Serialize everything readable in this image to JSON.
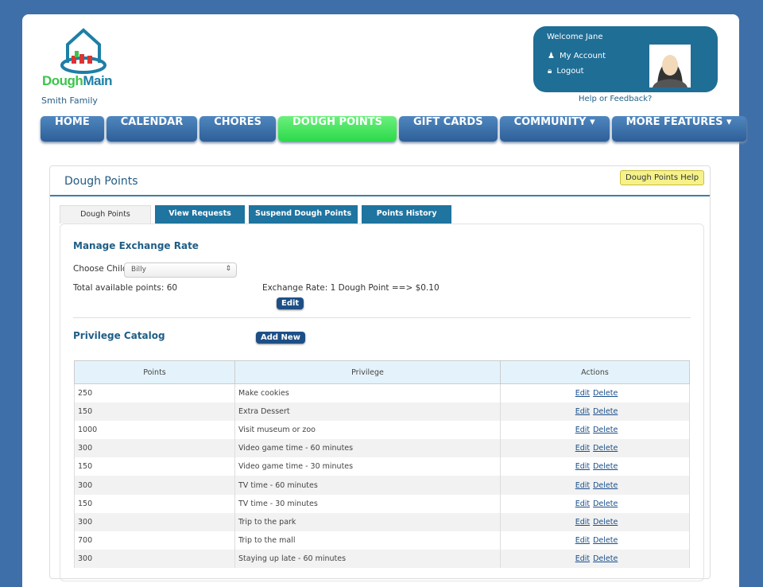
{
  "brand": {
    "part1": "Dough",
    "part2": "Main",
    "family": "Smith Family"
  },
  "account": {
    "welcome": "Welcome Jane",
    "my_account": "My Account",
    "logout": "Logout",
    "help": "Help or Feedback?"
  },
  "nav": [
    "HOME",
    "CALENDAR",
    "CHORES",
    "DOUGH POINTS",
    "GIFT CARDS",
    "COMMUNITY ▾",
    "MORE FEATURES ▾"
  ],
  "panel": {
    "title": "Dough Points",
    "help_button": "Dough Points Help",
    "tabs": [
      "Dough Points",
      "View Requests",
      "Suspend Dough Points",
      "Points History"
    ],
    "exchange": {
      "heading": "Manage Exchange Rate",
      "choose_label": "Choose Child",
      "child": "Billy",
      "total": "Total available points: 60",
      "rate": "Exchange Rate: 1 Dough Point ==> $0.10",
      "edit": "Edit"
    },
    "catalog": {
      "heading": "Privilege Catalog",
      "add_new": "Add New",
      "columns": [
        "Points",
        "Privilege",
        "Actions"
      ],
      "edit": "Edit",
      "delete": "Delete",
      "rows": [
        {
          "points": "250",
          "privilege": "Make cookies"
        },
        {
          "points": "150",
          "privilege": "Extra Dessert"
        },
        {
          "points": "1000",
          "privilege": "Visit museum or zoo"
        },
        {
          "points": "300",
          "privilege": "Video game time - 60 minutes"
        },
        {
          "points": "150",
          "privilege": "Video game time - 30 minutes"
        },
        {
          "points": "300",
          "privilege": "TV time - 60 minutes"
        },
        {
          "points": "150",
          "privilege": "TV time - 30 minutes"
        },
        {
          "points": "300",
          "privilege": "Trip to the park"
        },
        {
          "points": "700",
          "privilege": "Trip to the mall"
        },
        {
          "points": "300",
          "privilege": "Staying up late - 60 minutes"
        }
      ]
    }
  }
}
